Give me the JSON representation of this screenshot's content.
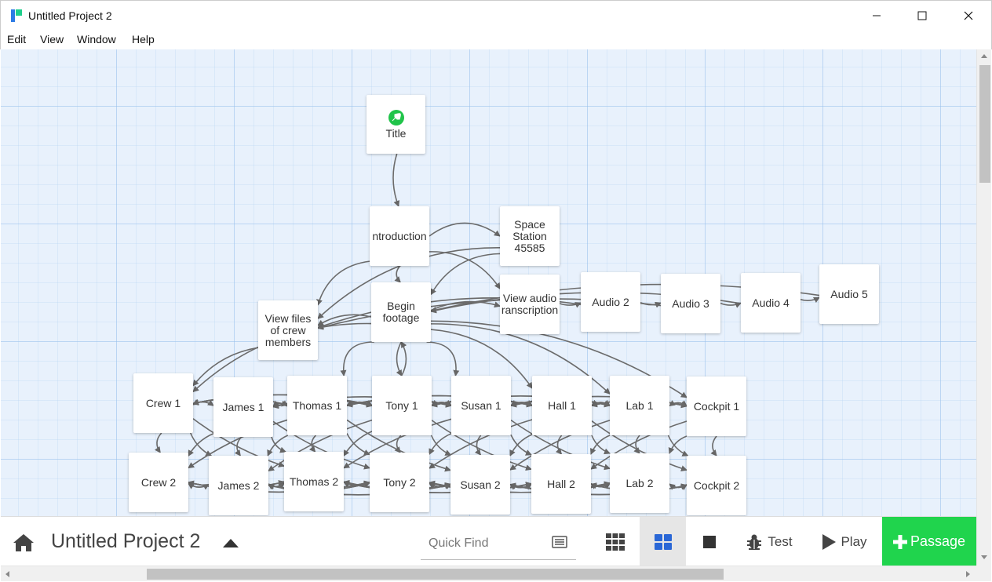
{
  "window": {
    "title": "Untitled Project 2",
    "controls": {
      "minimize": "—",
      "maximize": "☐",
      "close": "✕"
    }
  },
  "menu": {
    "items": [
      "Edit",
      "View",
      "Window",
      "Help"
    ]
  },
  "story_map": {
    "start_passage": "Title",
    "passages": [
      {
        "id": "title",
        "name": "Title",
        "start": true
      },
      {
        "id": "intro",
        "name": "ntroduction"
      },
      {
        "id": "space",
        "name": "Space\nStation\n45585"
      },
      {
        "id": "begin",
        "name": "Begin\nfootage"
      },
      {
        "id": "viewaudio",
        "name": "View audio\nranscription"
      },
      {
        "id": "audio2",
        "name": "Audio 2"
      },
      {
        "id": "audio3",
        "name": "Audio 3"
      },
      {
        "id": "audio4",
        "name": "Audio 4"
      },
      {
        "id": "audio5",
        "name": "Audio 5"
      },
      {
        "id": "viewfiles",
        "name": "View files\nof crew\nmembers"
      },
      {
        "id": "crew1",
        "name": "Crew 1"
      },
      {
        "id": "james1",
        "name": "James 1"
      },
      {
        "id": "thomas1",
        "name": "Thomas 1"
      },
      {
        "id": "tony1",
        "name": "Tony 1"
      },
      {
        "id": "susan1",
        "name": "Susan 1"
      },
      {
        "id": "hall1",
        "name": "Hall 1"
      },
      {
        "id": "lab1",
        "name": "Lab 1"
      },
      {
        "id": "cockpit1",
        "name": "Cockpit 1"
      },
      {
        "id": "crew2",
        "name": "Crew 2"
      },
      {
        "id": "james2",
        "name": "James 2"
      },
      {
        "id": "thomas2",
        "name": "Thomas 2"
      },
      {
        "id": "tony2",
        "name": "Tony 2"
      },
      {
        "id": "susan2",
        "name": "Susan 2"
      },
      {
        "id": "hall2",
        "name": "Hall 2"
      },
      {
        "id": "lab2",
        "name": "Lab 2"
      },
      {
        "id": "cockpit2",
        "name": "Cockpit 2"
      }
    ]
  },
  "toolbar": {
    "project_title": "Untitled Project 2",
    "quick_find_placeholder": "Quick Find",
    "test_label": "Test",
    "play_label": "Play",
    "passage_label": "Passage",
    "selected_zoom": "medium",
    "accent_color": "#20d44d"
  },
  "icons": {
    "home": "home-icon",
    "caret": "caret-up-icon",
    "find_options": "find-options-icon",
    "zoom_small": "grid-9-icon",
    "zoom_mid": "grid-4-icon",
    "zoom_large": "square-icon",
    "test": "bug-icon",
    "play": "play-icon",
    "passage": "plus-icon",
    "start": "rocket-icon"
  }
}
